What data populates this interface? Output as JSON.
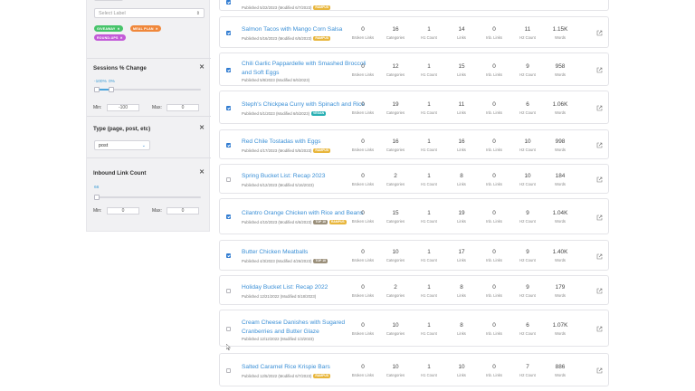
{
  "sidebar": {
    "label_select_placeholder": "Select Label",
    "tags": [
      {
        "text": "GIVEAWAY",
        "color": "#47c46a"
      },
      {
        "text": "MEAL PLAN",
        "color": "#f0873a"
      },
      {
        "text": "ROUND-UPS",
        "color": "#c359d8"
      }
    ],
    "sessions": {
      "title": "Sessions % Change",
      "range_min_label": "-100%",
      "range_max_label": "0%",
      "min_label": "Min:",
      "min_value": "-100",
      "max_label": "Max:",
      "max_value": "0"
    },
    "type": {
      "title": "Type (page, post, etc)",
      "selected": "post"
    },
    "inbound": {
      "title": "Inbound Link Count",
      "range_label": "66",
      "min_label": "Min:",
      "min_value": "0",
      "max_label": "Max:",
      "max_value": "0"
    }
  },
  "columns": {
    "broken": "Broken Links",
    "categories": "Categories",
    "h1": "H1 Count",
    "links": "Links",
    "inb": "Inb. Links",
    "h2": "H2 Count",
    "words": "Words"
  },
  "rows": [
    {
      "title_lines": [
        "",
        ""
      ],
      "published": "Published 5/22/2023 (Modified 6/7/2023)",
      "badge": "RAMPUS",
      "badge_class": "badge-ramp",
      "checked": true,
      "broken": "",
      "categories": "",
      "h1": "",
      "links": "",
      "inb": "",
      "h2": "",
      "words": ""
    },
    {
      "title_lines": [
        "Salmon Tacos with Mango Corn Salsa",
        ""
      ],
      "published": "Published 5/16/2023 (Modified 6/5/2023)",
      "badge": "RAMPUS",
      "badge_class": "badge-ramp",
      "checked": true,
      "broken": "0",
      "categories": "16",
      "h1": "1",
      "links": "14",
      "inb": "0",
      "h2": "11",
      "words": "1.15K"
    },
    {
      "title_lines": [
        "Chili Garlic Pappardelle with Smashed Broccoli",
        "and Soft Eggs"
      ],
      "published": "Published 5/8/2023 (Modified 6/6/2023)",
      "badge": "",
      "badge_class": "",
      "checked": true,
      "broken": "0",
      "categories": "12",
      "h1": "1",
      "links": "15",
      "inb": "0",
      "h2": "9",
      "words": "958"
    },
    {
      "title_lines": [
        "Steph's Chickpea Curry with Spinach and Rice",
        ""
      ],
      "published": "Published 5/1/2023 (Modified 6/5/2023)",
      "badge": "VEGAN",
      "badge_class": "badge-teal",
      "checked": true,
      "broken": "0",
      "categories": "19",
      "h1": "1",
      "links": "11",
      "inb": "0",
      "h2": "6",
      "words": "1.06K"
    },
    {
      "title_lines": [
        "Red Chile Tostadas with Eggs",
        ""
      ],
      "published": "Published 4/17/2023 (Modified 5/5/2023)",
      "badge": "RAMPUS",
      "badge_class": "badge-ramp",
      "checked": true,
      "broken": "0",
      "categories": "16",
      "h1": "1",
      "links": "16",
      "inb": "0",
      "h2": "10",
      "words": "998"
    },
    {
      "title_lines": [
        "Spring Bucket List: Recap 2023",
        ""
      ],
      "published": "Published 6/12/2023 (Modified 5/16/2023)",
      "badge": "",
      "badge_class": "",
      "checked": false,
      "broken": "0",
      "categories": "2",
      "h1": "1",
      "links": "8",
      "inb": "0",
      "h2": "10",
      "words": "184"
    },
    {
      "title_lines": [
        "Cilantro Orange Chicken with Rice and Beans",
        ""
      ],
      "published": "Published 4/10/2023 (Modified 6/6/2023)",
      "badge": "TOP 10",
      "badge_class": "badge-gray",
      "badge2": "RAMPUS",
      "badge2_class": "badge-ramp",
      "checked": true,
      "broken": "0",
      "categories": "15",
      "h1": "1",
      "links": "19",
      "inb": "0",
      "h2": "9",
      "words": "1.04K"
    },
    {
      "title_lines": [
        "Butter Chicken Meatballs",
        ""
      ],
      "published": "Published 4/3/2023 (Modified 4/26/2023)",
      "badge": "TOP 10",
      "badge_class": "badge-gray",
      "checked": true,
      "broken": "0",
      "categories": "10",
      "h1": "1",
      "links": "17",
      "inb": "0",
      "h2": "9",
      "words": "1.40K"
    },
    {
      "title_lines": [
        "Holiday Bucket List: Recap 2022",
        ""
      ],
      "published": "Published 12/21/2022 (Modified 5/18/2023)",
      "badge": "",
      "badge_class": "",
      "checked": false,
      "broken": "0",
      "categories": "2",
      "h1": "1",
      "links": "8",
      "inb": "0",
      "h2": "9",
      "words": "179"
    },
    {
      "title_lines": [
        "Cream Cheese Danishes with Sugared",
        "Cranberries and Butter Glaze"
      ],
      "published": "Published 12/12/2022 (Modified 1/3/2023)",
      "badge": "",
      "badge_class": "",
      "checked": false,
      "broken": "0",
      "categories": "10",
      "h1": "1",
      "links": "8",
      "inb": "0",
      "h2": "6",
      "words": "1.07K"
    },
    {
      "title_lines": [
        "Salted Caramel Rice Krispie Bars",
        ""
      ],
      "published": "Published 12/5/2022 (Modified 6/7/2023)",
      "badge": "RAMPUS",
      "badge_class": "badge-ramp",
      "checked": false,
      "broken": "0",
      "categories": "10",
      "h1": "1",
      "links": "10",
      "inb": "0",
      "h2": "7",
      "words": "886"
    }
  ]
}
